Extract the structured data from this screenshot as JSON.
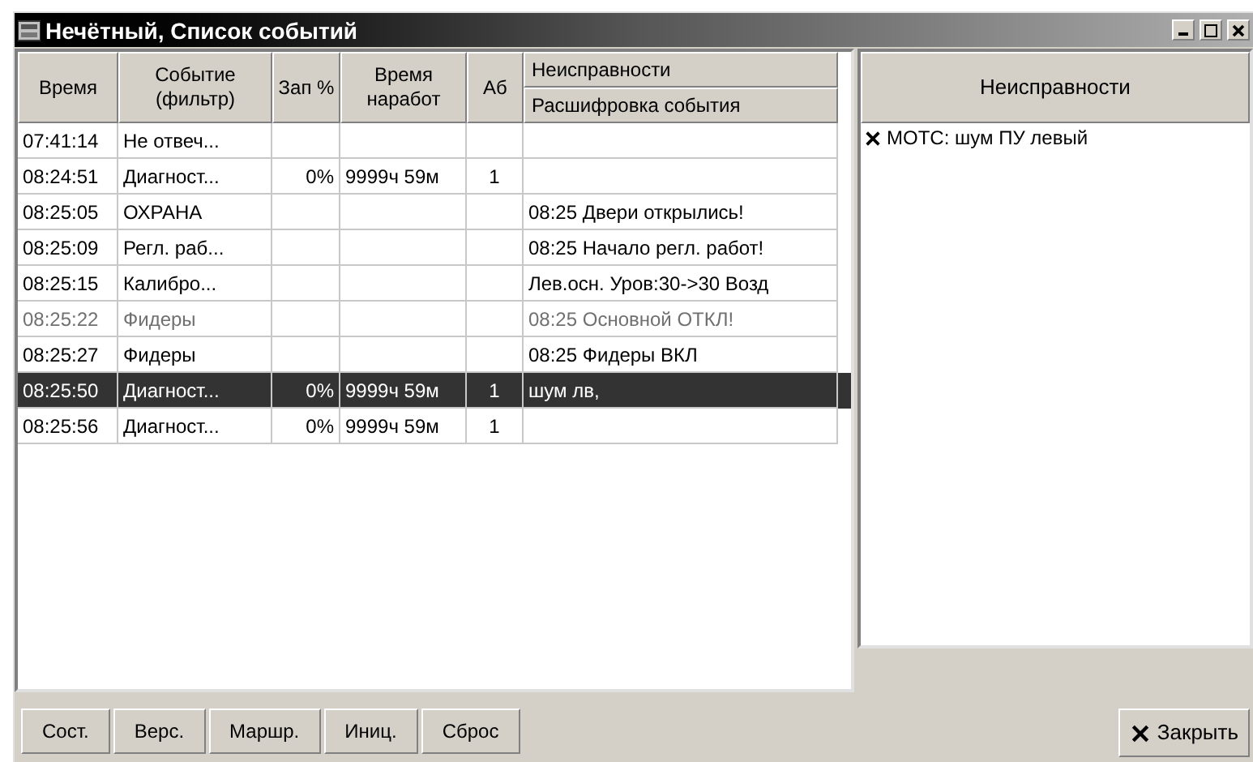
{
  "window": {
    "title": "Нечётный, Список событий"
  },
  "table": {
    "columns": [
      "Время",
      "Событие (фильтр)",
      "Зап %",
      "Время наработ",
      "Аб"
    ],
    "group_header": "Неисправности",
    "group_subheader": "Расшифровка события",
    "rows": [
      {
        "cells": [
          "07:41:14",
          "Не отвеч...",
          "",
          "",
          "",
          ""
        ],
        "selected": false,
        "dimmed": false
      },
      {
        "cells": [
          "08:24:51",
          "Диагност...",
          "0%",
          "9999ч 59м",
          "1",
          ""
        ],
        "selected": false,
        "dimmed": false
      },
      {
        "cells": [
          "08:25:05",
          "ОХРАНА",
          "",
          "",
          "",
          "08:25 Двери открылись!"
        ],
        "selected": false,
        "dimmed": false
      },
      {
        "cells": [
          "08:25:09",
          "Регл. раб...",
          "",
          "",
          "",
          "08:25 Начало регл. работ!"
        ],
        "selected": false,
        "dimmed": false
      },
      {
        "cells": [
          "08:25:15",
          "Калибро...",
          "",
          "",
          "",
          "Лев.осн. Уров:30->30 Возд"
        ],
        "selected": false,
        "dimmed": false
      },
      {
        "cells": [
          "08:25:22",
          "Фидеры",
          "",
          "",
          "",
          "08:25 Основной ОТКЛ!"
        ],
        "selected": false,
        "dimmed": true
      },
      {
        "cells": [
          "08:25:27",
          "Фидеры",
          "",
          "",
          "",
          "08:25 Фидеры ВКЛ"
        ],
        "selected": false,
        "dimmed": false
      },
      {
        "cells": [
          "08:25:50",
          "Диагност...",
          "0%",
          "9999ч 59м",
          "1",
          "шум лв,"
        ],
        "selected": true,
        "dimmed": false
      },
      {
        "cells": [
          "08:25:56",
          "Диагност...",
          "0%",
          "9999ч 59м",
          "1",
          ""
        ],
        "selected": false,
        "dimmed": false
      }
    ]
  },
  "faults": {
    "title": "Неисправности",
    "items": [
      "МОТС: шум ПУ левый"
    ]
  },
  "buttons": [
    "Сост.",
    "Верс.",
    "Маршр.",
    "Иниц.",
    "Сброс"
  ],
  "close_button": "Закрыть"
}
